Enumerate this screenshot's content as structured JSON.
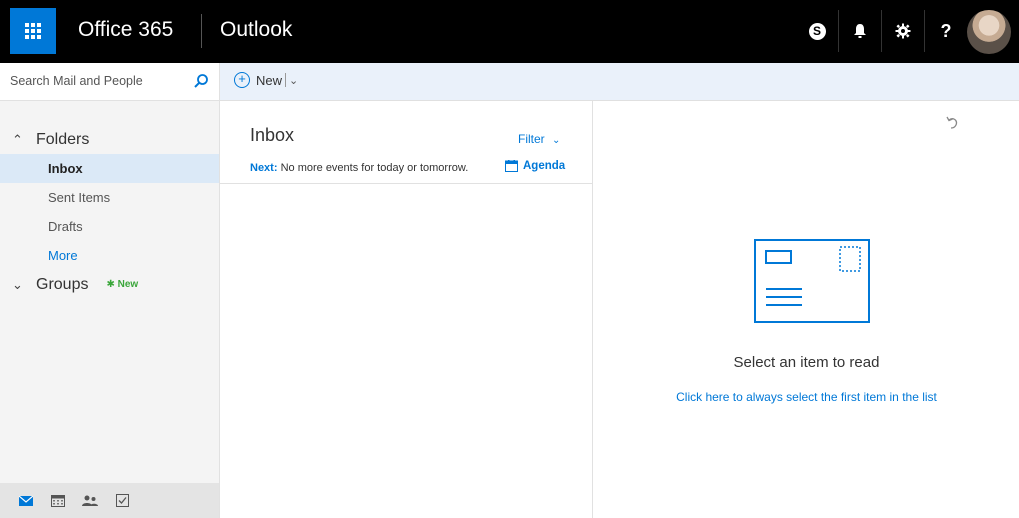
{
  "topbar": {
    "brand": "Office 365",
    "app": "Outlook",
    "icons": [
      "skype-icon",
      "bell-icon",
      "gear-icon",
      "help-icon"
    ],
    "skype_glyph": "S",
    "help_glyph": "?"
  },
  "search": {
    "placeholder": "Search Mail and People"
  },
  "command": {
    "new_label": "New"
  },
  "folders": {
    "header": "Folders",
    "items": [
      {
        "label": "Inbox",
        "selected": true
      },
      {
        "label": "Sent Items"
      },
      {
        "label": "Drafts"
      }
    ],
    "more": "More"
  },
  "groups": {
    "header": "Groups",
    "new_tag": "New"
  },
  "inbox": {
    "title": "Inbox",
    "filter": "Filter",
    "next_label": "Next:",
    "next_text": "No more events for today or tomorrow.",
    "agenda": "Agenda"
  },
  "reading": {
    "select_text": "Select an item to read",
    "select_link": "Click here to always select the first item in the list"
  },
  "colors": {
    "accent": "#0078d7",
    "topbar": "#000000",
    "selected": "#dbe9f7",
    "new_tag": "#3aa63a"
  }
}
